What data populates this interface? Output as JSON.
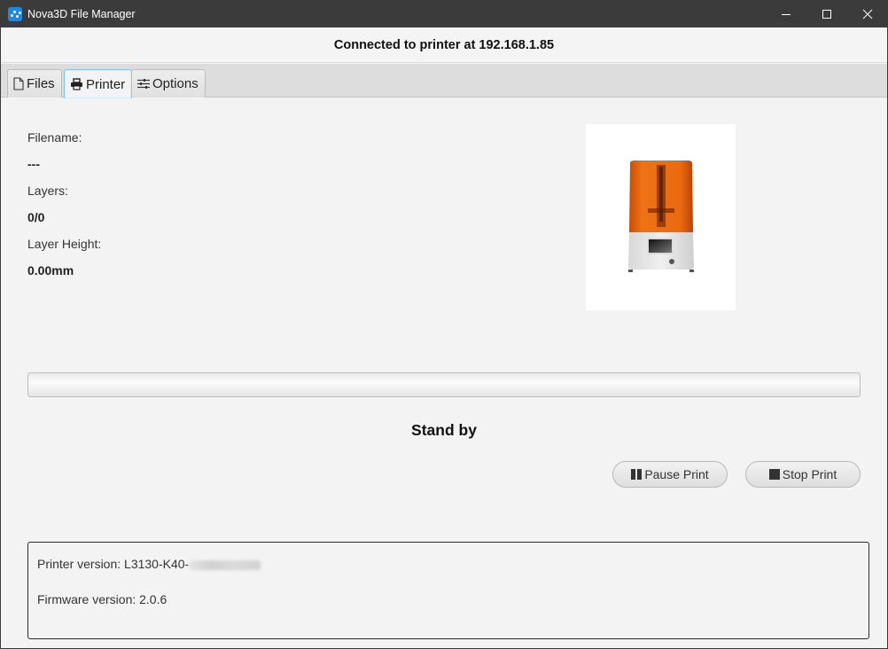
{
  "window": {
    "title": "Nova3D File Manager",
    "app_icon": "nova3d-logo-icon",
    "controls": {
      "minimize": "minimize-icon",
      "maximize": "maximize-icon",
      "close": "close-icon"
    }
  },
  "header": {
    "connection_status": "Connected to printer at 192.168.1.85"
  },
  "tabs": [
    {
      "label": "Files",
      "icon": "file-icon",
      "active": false
    },
    {
      "label": "Printer",
      "icon": "printer-icon",
      "active": true
    },
    {
      "label": "Options",
      "icon": "sliders-icon",
      "active": false
    }
  ],
  "print_info": {
    "filename_label": "Filename:",
    "filename_value": "---",
    "layers_label": "Layers:",
    "layers_value": "0/0",
    "layer_height_label": "Layer Height:",
    "layer_height_value": "0.00mm"
  },
  "printer_image": {
    "alt": "Nova3D resin printer with orange UV cover",
    "accent_color": "#e8630a"
  },
  "progress": {
    "percent": 0
  },
  "status": {
    "text": "Stand by"
  },
  "actions": {
    "pause_label": "Pause Print",
    "pause_icon": "pause-icon",
    "stop_label": "Stop Print",
    "stop_icon": "stop-icon"
  },
  "versions": {
    "printer_version_label": "Printer version: L3130-K40-",
    "printer_version_redacted": true,
    "firmware_version_label": "Firmware version: 2.0.6"
  }
}
